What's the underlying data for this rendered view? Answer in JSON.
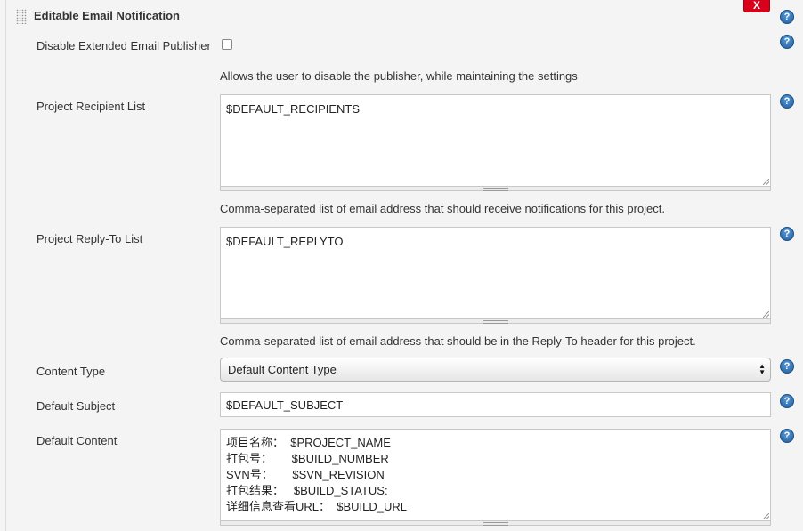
{
  "section": {
    "title": "Editable Email Notification",
    "delete_label": "X",
    "help_glyph": "?"
  },
  "fields": {
    "disable_publisher": {
      "label": "Disable Extended Email Publisher",
      "checked": false,
      "description": "Allows the user to disable the publisher, while maintaining the settings"
    },
    "recipient_list": {
      "label": "Project Recipient List",
      "value": "$DEFAULT_RECIPIENTS",
      "description": "Comma-separated list of email address that should receive notifications for this project."
    },
    "reply_to_list": {
      "label": "Project Reply-To List",
      "value": "$DEFAULT_REPLYTO",
      "description": "Comma-separated list of email address that should be in the Reply-To header for this project."
    },
    "content_type": {
      "label": "Content Type",
      "selected": "Default Content Type"
    },
    "default_subject": {
      "label": "Default Subject",
      "value": "$DEFAULT_SUBJECT"
    },
    "default_content": {
      "label": "Default Content",
      "value": "项目名称：  $PROJECT_NAME\n打包号：      $BUILD_NUMBER\nSVN号：      $SVN_REVISION\n打包结果：   $BUILD_STATUS:\n详细信息查看URL：  $BUILD_URL"
    }
  },
  "colors": {
    "background": "#f4f4f4",
    "delete_button": "#d9001b",
    "help_icon": "#2f6fb3"
  },
  "icons": {
    "help": "help-icon",
    "drag": "drag-handle-icon",
    "select_arrows": "select-arrows-icon"
  }
}
